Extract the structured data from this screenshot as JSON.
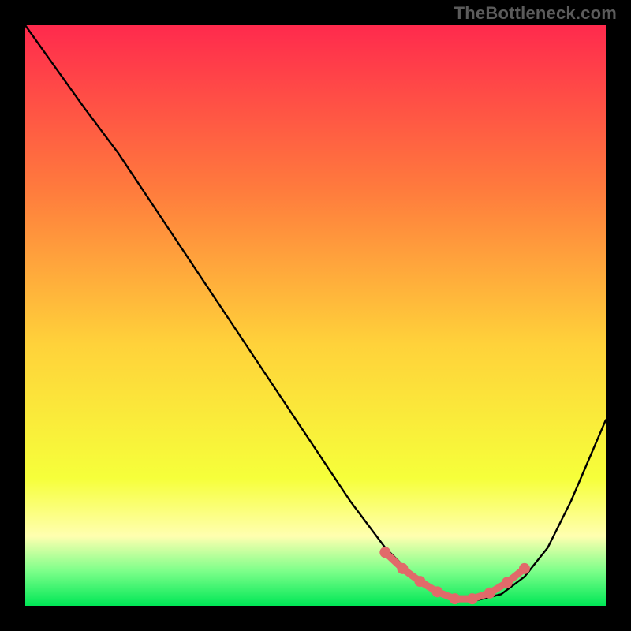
{
  "watermark": "TheBottleneck.com",
  "colors": {
    "bg": "#000000",
    "watermark": "#5b5b5b",
    "curve": "#000000",
    "markers": "#e16a6a",
    "grad_top": "#ff2a4d",
    "grad_upper_mid": "#ff7a3d",
    "grad_mid": "#ffd23a",
    "grad_lower_mid": "#f6ff3a",
    "grad_band_light": "#ffffb0",
    "grad_green_light": "#7dff8a",
    "grad_green": "#00e756"
  },
  "chart_data": {
    "type": "line",
    "title": "",
    "xlabel": "",
    "ylabel": "",
    "xlim": [
      0,
      100
    ],
    "ylim": [
      0,
      100
    ],
    "series": [
      {
        "name": "bottleneck-curve",
        "x": [
          0,
          5,
          10,
          16,
          24,
          32,
          40,
          48,
          56,
          62,
          66,
          70,
          74,
          78,
          82,
          86,
          90,
          94,
          100
        ],
        "values": [
          100,
          93,
          86,
          78,
          66,
          54,
          42,
          30,
          18,
          10,
          6,
          3,
          1,
          1,
          2,
          5,
          10,
          18,
          32
        ]
      }
    ],
    "markers": {
      "name": "optimal-band",
      "x": [
        62,
        65,
        68,
        71,
        74,
        77,
        80,
        83,
        86
      ],
      "values": [
        9.2,
        6.4,
        4.2,
        2.4,
        1.2,
        1.2,
        2.2,
        4.0,
        6.4
      ]
    }
  }
}
